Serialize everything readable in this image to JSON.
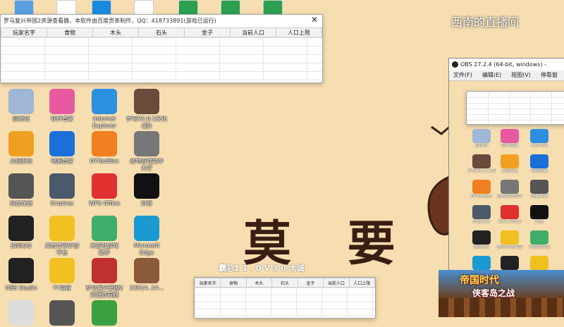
{
  "watermark": "西南的直播间",
  "resource_window": {
    "title": "罗马复兴帝国2资源查看器，本软件由百度贡茶制作，QQ：418733891(游戏已运行)",
    "columns": [
      "玩家名字",
      "食物",
      "木头",
      "石头",
      "金子",
      "当前人口",
      "人口上限"
    ]
  },
  "desktop_icons": [
    {
      "label": "回收站",
      "icon": "recycle-bin-icon",
      "color": "#9fb6d6"
    },
    {
      "label": "软件管家",
      "icon": "software-manager-icon",
      "color": "#e85aa0"
    },
    {
      "label": "Internet\nExplorer",
      "icon": "internet-explorer-icon",
      "color": "#2d8fe0"
    },
    {
      "label": "罗马V2.0.1汉化\n(游)",
      "icon": "game-icon",
      "color": "#6a4a3a"
    },
    {
      "label": "火绒安全",
      "icon": "huorong-icon",
      "color": "#f0a020"
    },
    {
      "label": "电脑管家",
      "icon": "pc-manager-icon",
      "color": "#1a6fd8"
    },
    {
      "label": "DYToolBox",
      "icon": "dytoolbox-icon",
      "color": "#f08020"
    },
    {
      "label": "战地游戏助手\n大厅",
      "icon": "game-assistant-icon",
      "color": "#777"
    },
    {
      "label": "热血龙源",
      "icon": "dragon-icon",
      "color": "#555"
    },
    {
      "label": "Empires",
      "icon": "empires-icon",
      "color": "#4a5a6a"
    },
    {
      "label": "WPS Office",
      "icon": "wps-icon",
      "color": "#e03030"
    },
    {
      "label": "抖音",
      "icon": "tiktok-icon",
      "color": "#111"
    },
    {
      "label": "腾讯QQ",
      "icon": "qq-icon",
      "color": "#222"
    },
    {
      "label": "奥奇传说手游\n平台",
      "icon": "duck-icon",
      "color": "#f0c020"
    },
    {
      "label": "米游社游戏\n助手",
      "icon": "rabbit-icon",
      "color": "#3fae6a"
    },
    {
      "label": "Microsoft\nEdge",
      "icon": "edge-icon",
      "color": "#1a9ad0"
    },
    {
      "label": "OBS Studio",
      "icon": "obs-icon",
      "color": "#222"
    },
    {
      "label": "YY语音",
      "icon": "yy-icon",
      "color": "#f0c020"
    },
    {
      "label": "罗马复兴帝国2\n资源查看器",
      "icon": "viewer-icon",
      "color": "#c03030"
    },
    {
      "label": "23514..14...",
      "icon": "screenshot-icon",
      "color": "#8a5a3a"
    },
    {
      "label": "",
      "icon": "bear-icon",
      "color": "#ddd"
    },
    {
      "label": "",
      "icon": "dragon2-icon",
      "color": "#555"
    },
    {
      "label": "",
      "icon": "browser-icon",
      "color": "#3aa040"
    }
  ],
  "top_icons": [
    {
      "icon": "folder-icon",
      "color": "#5aa0e0"
    },
    {
      "icon": "file-icon",
      "color": "#ffffff"
    },
    {
      "icon": "k-app-icon",
      "color": "#1a8ae0"
    },
    {
      "icon": "wps-doc-icon",
      "color": "#ffffff"
    },
    {
      "icon": "sheet-icon",
      "color": "#2aa050"
    },
    {
      "icon": "sheet2-icon",
      "color": "#2aa050"
    },
    {
      "icon": "sheet3-icon",
      "color": "#2aa050"
    }
  ],
  "big_text": "莫 要",
  "subtitle_text": "霸总1 1 . 0 V 3 0 大诚",
  "obs": {
    "title": "OBS 27.2.4 (64-bit, windows) -",
    "menu": [
      "文件(F)",
      "编辑(E)",
      "视图(V)",
      "停靠窗"
    ]
  },
  "game_ad": {
    "title": "帝国时代",
    "subtitle": "侠客岛之战"
  }
}
